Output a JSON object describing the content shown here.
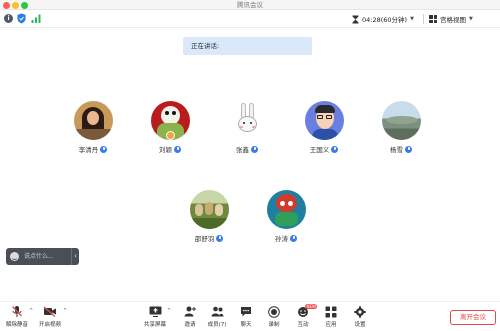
{
  "window": {
    "title": "腾讯会议"
  },
  "infobar": {
    "timer_text": "04:28(60分钟)",
    "view_label": "宫格视图"
  },
  "banner": {
    "speaking_label": "正在讲话:"
  },
  "participants": [
    {
      "name": "李清丹"
    },
    {
      "name": "刘颖"
    },
    {
      "name": "张鑫"
    },
    {
      "name": "王国义"
    },
    {
      "name": "杨雪"
    },
    {
      "name": "邵舒羽"
    },
    {
      "name": "孙涛"
    }
  ],
  "chat": {
    "placeholder": "说点什么..."
  },
  "toolbar": {
    "items": [
      {
        "label": "解除静音"
      },
      {
        "label": "开启视频"
      },
      {
        "label": "共享屏幕"
      },
      {
        "label": "邀请"
      },
      {
        "label": "成员(7)"
      },
      {
        "label": "聊天"
      },
      {
        "label": "录制"
      },
      {
        "label": "互动",
        "badge": "NEW"
      },
      {
        "label": "应用"
      },
      {
        "label": "设置"
      }
    ],
    "leave_label": "离开会议"
  },
  "colors": {
    "accent": "#3b7be8",
    "leave": "#e5484d",
    "banner_bg": "#dbe8fa",
    "chat_bg": "#4a4f57"
  }
}
